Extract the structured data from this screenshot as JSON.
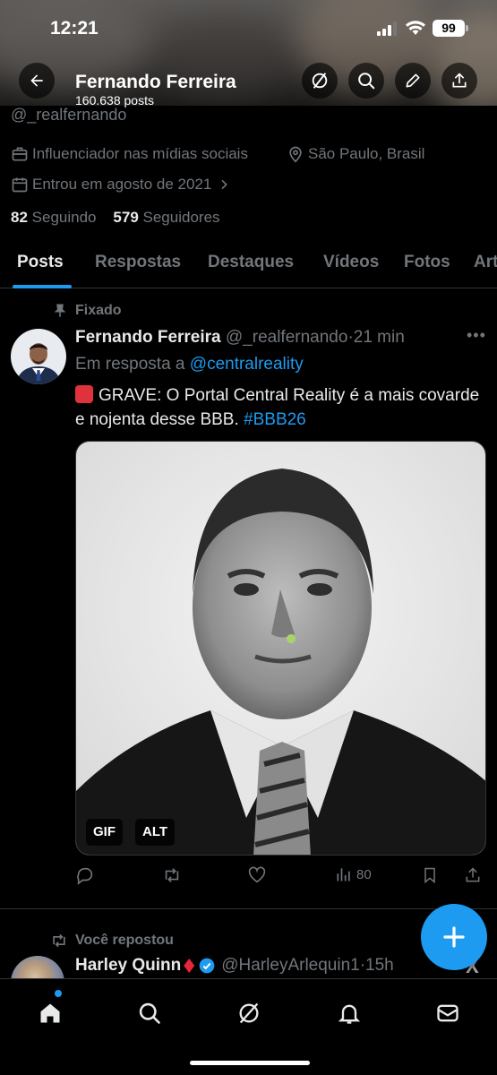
{
  "status_bar": {
    "time": "12:21",
    "battery": "99"
  },
  "header": {
    "name": "Fernando Ferreira",
    "posts": "160.638 posts"
  },
  "profile": {
    "handle": "@_realfernando",
    "category": "Influenciador nas mídias sociais",
    "location": "São Paulo, Brasil",
    "joined": "Entrou em agosto de 2021",
    "following_count": "82",
    "following_label": "Seguindo",
    "followers_count": "579",
    "followers_label": "Seguidores"
  },
  "tabs": [
    {
      "label": "Posts"
    },
    {
      "label": "Respostas"
    },
    {
      "label": "Destaques"
    },
    {
      "label": "Vídeos"
    },
    {
      "label": "Fotos"
    },
    {
      "label": "Art"
    }
  ],
  "pinned_post": {
    "pinned_label": "Fixado",
    "author_name": "Fernando Ferreira",
    "author_handle": "@_realfernando",
    "sep": "·",
    "time": "21 min",
    "reply_prefix": "Em resposta a",
    "reply_to": "@centralreality",
    "text": "GRAVE: O Portal Central Reality é a mais covarde e nojenta desse BBB.",
    "hashtag": "#BBB26",
    "badges": {
      "gif": "GIF",
      "alt": "ALT"
    },
    "views": "80"
  },
  "next_post": {
    "repost_label": "Você repostou",
    "author_name": "Harley Quinn",
    "author_handle": "@HarleyArlequin1",
    "sep": "·",
    "time": "15h"
  },
  "colors": {
    "accent": "#1d9bf0",
    "muted": "#71767b",
    "text": "#e7e9ea",
    "divider": "#2f3336"
  },
  "icons": [
    "back-arrow-icon",
    "grok-icon",
    "search-icon",
    "edit-icon",
    "share-icon",
    "briefcase-icon",
    "location-icon",
    "calendar-icon",
    "chevron-right-icon",
    "pin-icon",
    "reply-icon",
    "repost-icon",
    "like-icon",
    "views-icon",
    "bookmark-icon",
    "plus-icon",
    "home-icon",
    "notifications-icon",
    "messages-icon"
  ]
}
